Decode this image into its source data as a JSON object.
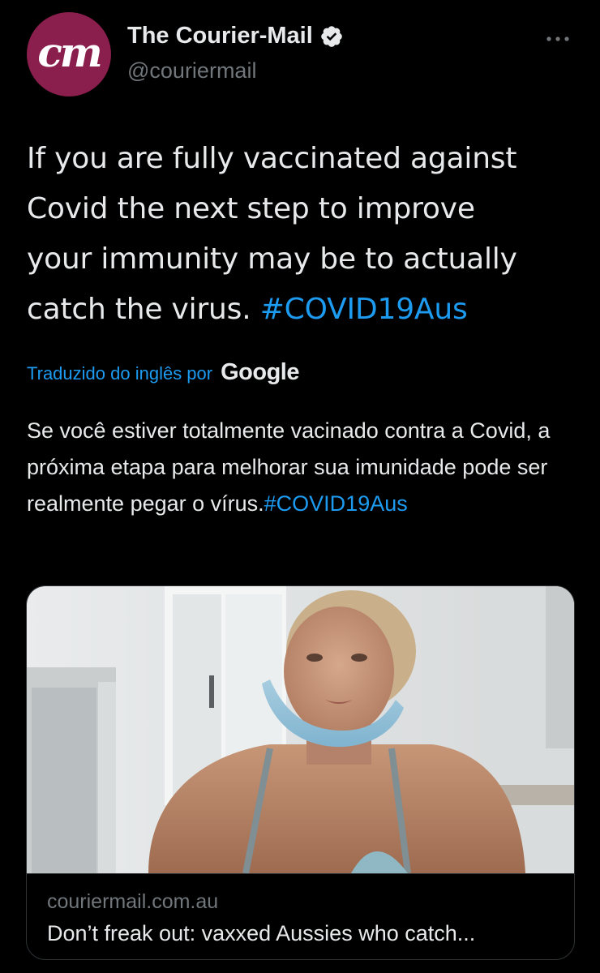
{
  "tweet": {
    "author": {
      "avatar_text": "cm",
      "display_name": "The Courier-Mail",
      "handle": "@couriermail",
      "avatar_color": "#8a1e4d"
    },
    "verified_icon": "verified-badge-icon",
    "more_icon": "more-options-icon",
    "text": {
      "line1": "If you are fully vaccinated against",
      "line2": "Covid the next step to improve",
      "line3": "your immunity may be to actually",
      "line4_prefix": "catch the virus. ",
      "hashtag": "#COVID19Aus"
    },
    "translation": {
      "label": "Traduzido do inglês por",
      "provider": "Google",
      "text": "Se você estiver totalmente vacinado contra a Covid, a próxima etapa para melhorar sua imunidade pode ser realmente pegar o vírus.",
      "hashtag": "#COVID19Aus"
    },
    "card": {
      "domain": "couriermail.com.au",
      "title": "Don’t freak out: vaxxed Aussies who catch..."
    },
    "colors": {
      "background": "#000000",
      "text": "#e7e9ea",
      "secondary": "#71767b",
      "accent": "#1d9bf0",
      "border": "#2f3336"
    }
  }
}
